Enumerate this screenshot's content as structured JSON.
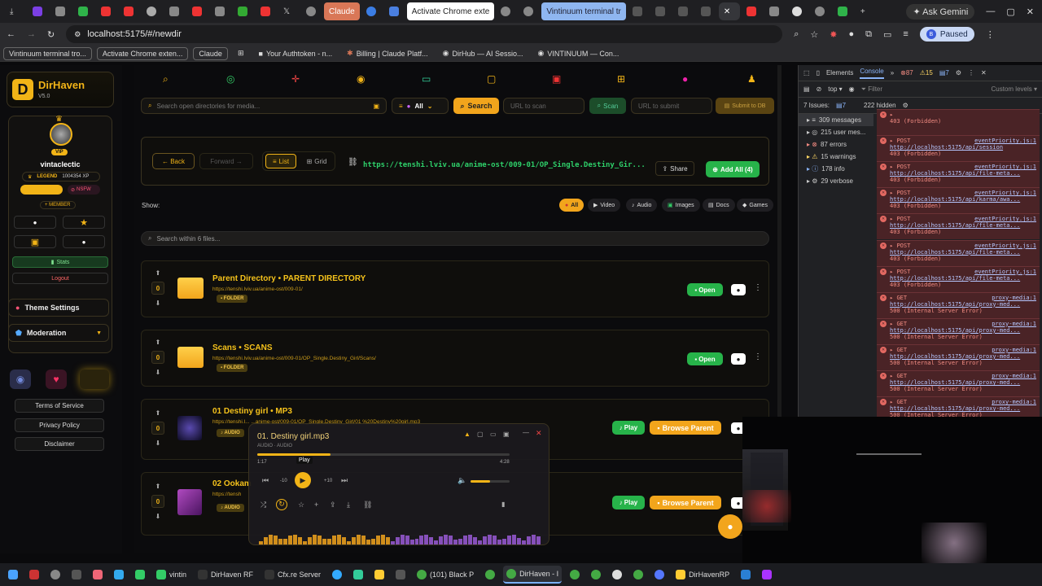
{
  "browser": {
    "tabs": [
      {
        "label": "Claude",
        "style": "claude"
      },
      {
        "label": "Activate Chrome exte",
        "style": "ach"
      },
      {
        "label": "Vintinuum terminal tr",
        "style": "vint"
      }
    ],
    "profile_ask": "Ask Gemini",
    "url": "localhost:5175/#/newdir",
    "profile_status": "Paused",
    "profile_initial": "B",
    "bookmarks": [
      {
        "label": "Vintinuum terminal tro...",
        "boxed": true
      },
      {
        "label": "Activate Chrome exten...",
        "boxed": true
      },
      {
        "label": "Claude",
        "boxed": true
      },
      {
        "label": "Your Authtoken - n...",
        "boxed": false
      },
      {
        "label": "Billing | Claude Platf...",
        "boxed": false
      },
      {
        "label": "DirHub — AI Sessio...",
        "boxed": false
      },
      {
        "label": "VINTINUUM — Con...",
        "boxed": false
      }
    ]
  },
  "sidebar": {
    "app_name": "DirHaven",
    "version": "V5.0",
    "vip": "VIP",
    "username": "vintaclectic",
    "legend": "LEGEND",
    "xp": "1004354 XP",
    "nsfw": "NSFW",
    "member": "+ MEMBER",
    "stats": "Stats",
    "logout": "Logout",
    "theme_settings": "Theme Settings",
    "moderation": "Moderation",
    "terms": "Terms of Service",
    "privacy": "Privacy Policy",
    "disclaimer": "Disclaimer"
  },
  "search": {
    "placeholder": "Search open directories for media...",
    "filter_all": "All",
    "search_btn": "Search",
    "scan_placeholder": "URL to scan",
    "scan_btn": "Scan",
    "submit_placeholder": "URL to submit",
    "submit_btn": "Submit to DB"
  },
  "browser_panel": {
    "back": "← Back",
    "forward": "Forward →",
    "list": "List",
    "grid": "Grid",
    "path": "https://tenshi.lviv.ua/anime-ost/009-01/OP_Single.Destiny_Gir...",
    "share": "Share",
    "add_all": "Add All (4)",
    "show_label": "Show:",
    "filters": [
      "All",
      "Video",
      "Audio",
      "Images",
      "Docs",
      "Games"
    ],
    "search_within": "Search within 6 files..."
  },
  "entries": [
    {
      "title": "Parent Directory • PARENT DIRECTORY",
      "path": "https://tenshi.lviv.ua/anime-ost/009-01/",
      "badge": "FOLDER",
      "votes": "0",
      "action": "Open"
    },
    {
      "title": "Scans • SCANS",
      "path": "https://tenshi.lviv.ua/anime-ost/009-01/OP_Single.Destiny_Girl/Scans/",
      "badge": "FOLDER",
      "votes": "0",
      "action": "Open"
    },
    {
      "title": "01 Destiny girl • MP3",
      "path": "https://tenshi.l... ...anime-ost/009-01/OP_Single.Destiny_Girl/01 %20Destiny%20girl.mp3",
      "badge": "AUDIO",
      "votes": "0",
      "action": "Play",
      "action2": "Browse Parent"
    },
    {
      "title": "02 Ookam",
      "path": "https://tensh",
      "badge": "AUDIO",
      "votes": "0",
      "action": "Play",
      "action2": "Browse Parent"
    }
  ],
  "player": {
    "title": "01. Destiny girl.mp3",
    "subtitle": "AUDIO · AUDIO",
    "current": "1:17",
    "duration": "4:28",
    "progress": 0.29,
    "volume": 0.5,
    "tooltip": "Play",
    "skip_back": "-10",
    "skip_fwd": "+10"
  },
  "devtools": {
    "tabs": [
      "Elements",
      "Console"
    ],
    "errors": "87",
    "warnings": "15",
    "info_count": "7",
    "context": "top",
    "filter_placeholder": "Filter",
    "levels": "Custom levels ▾",
    "issues": "7 Issues:",
    "issues_count": "7",
    "hidden": "222 hidden",
    "categories": [
      "309 messages",
      "215 user mes...",
      "87 errors",
      "15 warnings",
      "178 info",
      "29 verbose"
    ],
    "messages": [
      {
        "method": "",
        "src": "",
        "url": "",
        "status": "403 (Forbidden)"
      },
      {
        "method": "POST",
        "src": "eventPriority.js:1",
        "url": "http://localhost:5175/api/session",
        "status": "403 (Forbidden)"
      },
      {
        "method": "POST",
        "src": "eventPriority.js:1",
        "url": "http://localhost:5175/api/file-meta...",
        "status": "403 (Forbidden)"
      },
      {
        "method": "POST",
        "src": "eventPriority.js:1",
        "url": "http://localhost:5175/api/karma/awa...",
        "status": "403 (Forbidden)"
      },
      {
        "method": "POST",
        "src": "eventPriority.js:1",
        "url": "http://localhost:5175/api/file-meta...",
        "status": "403 (Forbidden)"
      },
      {
        "method": "POST",
        "src": "eventPriority.js:1",
        "url": "http://localhost:5175/api/file-meta...",
        "status": "403 (Forbidden)"
      },
      {
        "method": "POST",
        "src": "eventPriority.js:1",
        "url": "http://localhost:5175/api/file-meta...",
        "status": "403 (Forbidden)"
      },
      {
        "method": "GET",
        "src": "proxy-media:1",
        "url": "http://localhost:5175/api/proxy-med...",
        "status": "500 (Internal Server Error)"
      },
      {
        "method": "GET",
        "src": "proxy-media:1",
        "url": "http://localhost:5175/api/proxy-med...",
        "status": "500 (Internal Server Error)"
      },
      {
        "method": "GET",
        "src": "proxy-media:1",
        "url": "http://localhost:5175/api/proxy-med...",
        "status": "500 (Internal Server Error)"
      },
      {
        "method": "GET",
        "src": "proxy-media:1",
        "url": "http://localhost:5175/api/proxy-med...",
        "status": "500 (Internal Server Error)"
      },
      {
        "method": "GET",
        "src": "proxy-media:1",
        "url": "http://localhost:5175/api/proxy-med...",
        "status": "500 (Internal Server Error)"
      },
      {
        "method": "GET",
        "src": "proxy-media:1",
        "url": "",
        "status": ""
      }
    ]
  },
  "taskbar": {
    "items": [
      {
        "label": "vintin",
        "active": false
      },
      {
        "label": "DirHaven RF",
        "active": false
      },
      {
        "label": "Cfx.re Server",
        "active": false
      },
      {
        "label": "(101) Black P",
        "active": false
      },
      {
        "label": "DirHaven - I",
        "active": true
      },
      {
        "label": "DirHavenRP",
        "active": false
      }
    ]
  },
  "colors": {
    "accent": "#f2b417",
    "green": "#27b34a",
    "error_bg": "#4a2326"
  }
}
